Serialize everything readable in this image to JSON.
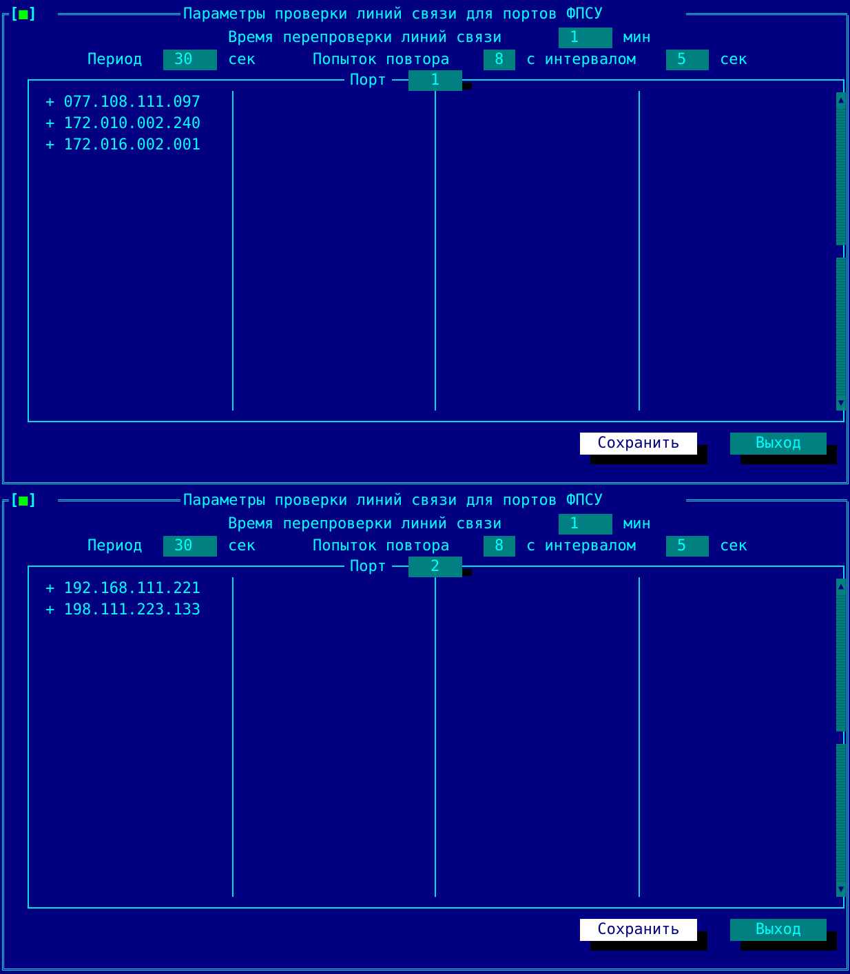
{
  "dialogs": [
    {
      "close_box": "[■]",
      "title": "Параметры проверки линий связи для портов ФПСУ",
      "recheck_label": "Время перепроверки линий связи",
      "recheck_value": "1",
      "recheck_unit": "мин",
      "period_label": "Период",
      "period_value": "30",
      "period_unit": "сек",
      "retries_label": "Попыток повтора",
      "retries_value": "8",
      "interval_label": "с интервалом",
      "interval_value": "5",
      "interval_unit": "сек",
      "port_label": "Порт",
      "port_value": "1",
      "addresses": [
        "+ 077.108.111.097",
        "+ 172.010.002.240",
        "+ 172.016.002.001"
      ],
      "save_label": "Сохранить",
      "exit_label": "Выход"
    },
    {
      "close_box": "[■]",
      "title": "Параметры проверки линий связи для портов ФПСУ",
      "recheck_label": "Время перепроверки линий связи",
      "recheck_value": "1",
      "recheck_unit": "мин",
      "period_label": "Период",
      "period_value": "30",
      "period_unit": "сек",
      "retries_label": "Попыток повтора",
      "retries_value": "8",
      "interval_label": "с интервалом",
      "interval_value": "5",
      "interval_unit": "сек",
      "port_label": "Порт",
      "port_value": "2",
      "addresses": [
        "+ 192.168.111.221",
        "+ 198.111.223.133"
      ],
      "save_label": "Сохранить",
      "exit_label": "Выход"
    }
  ],
  "colors": {
    "background": "#000080",
    "text": "#00ffff",
    "field": "#008080",
    "close_square": "#00ff00",
    "save_button": "#ffffff"
  },
  "icons": {
    "scroll_up": "scroll-up-arrow-icon",
    "scroll_down": "scroll-down-arrow-icon",
    "close": "close-box-icon"
  }
}
